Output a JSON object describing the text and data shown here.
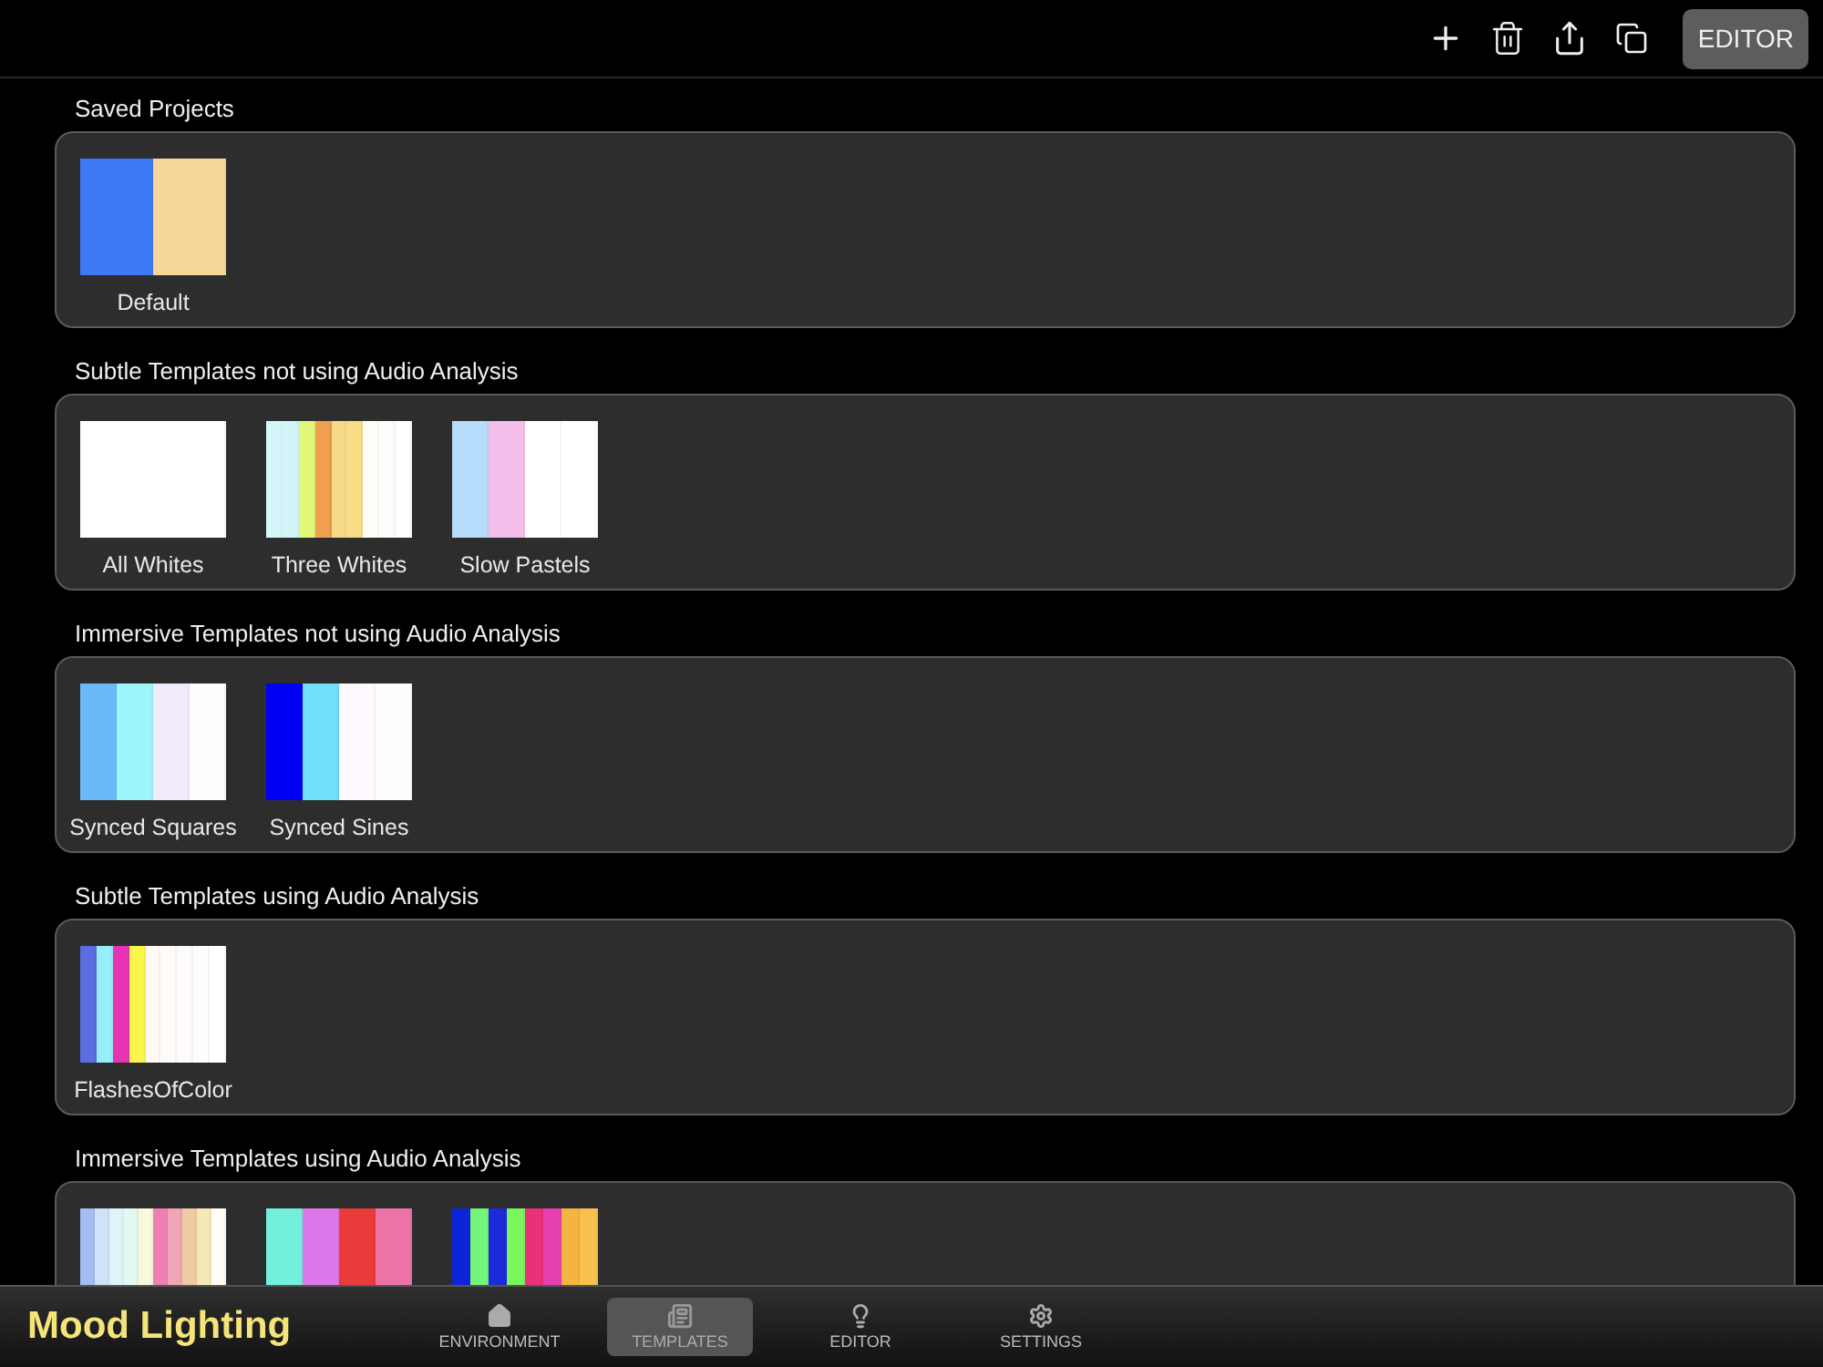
{
  "toolbar": {
    "editor_button": "EDITOR"
  },
  "sections": [
    {
      "title": "Saved Projects",
      "templates": [
        {
          "name": "Default",
          "stripes": [
            {
              "color": "#3d78f5"
            },
            {
              "color": "#f7d79b"
            }
          ]
        }
      ]
    },
    {
      "title": "Subtle Templates not using Audio Analysis",
      "templates": [
        {
          "name": "All Whites",
          "stripes": [
            {
              "color": "#ffffff"
            }
          ]
        },
        {
          "name": "Three Whites",
          "stripes": [
            {
              "color": "#d6f6fb"
            },
            {
              "color": "#d3f5fa"
            },
            {
              "color": "#e1f77a"
            },
            {
              "color": "#ef9f4e"
            },
            {
              "color": "#f7d98a"
            },
            {
              "color": "#f7dd86"
            },
            {
              "color": "#fffdf8"
            },
            {
              "color": "#fdfdfd"
            },
            {
              "color": "#ffffff"
            }
          ]
        },
        {
          "name": "Slow Pastels",
          "stripes": [
            {
              "color": "#b5dcfb"
            },
            {
              "color": "#f3bdec"
            },
            {
              "color": "#ffffff"
            },
            {
              "color": "#ffffff"
            }
          ]
        }
      ]
    },
    {
      "title": "Immersive Templates not using Audio Analysis",
      "templates": [
        {
          "name": "Synced Squares",
          "stripes": [
            {
              "color": "#6bbaf8"
            },
            {
              "color": "#9ef5fa"
            },
            {
              "color": "#f1eafb"
            },
            {
              "color": "#fefcff"
            }
          ]
        },
        {
          "name": "Synced Sines",
          "stripes": [
            {
              "color": "#0000f5"
            },
            {
              "color": "#6fdffa"
            },
            {
              "color": "#fdf9ff"
            },
            {
              "color": "#fffcfd"
            }
          ]
        }
      ]
    },
    {
      "title": "Subtle Templates using Audio Analysis",
      "templates": [
        {
          "name": "FlashesOfColor",
          "stripes": [
            {
              "color": "#5b6ee0"
            },
            {
              "color": "#96eef8"
            },
            {
              "color": "#e733b4"
            },
            {
              "color": "#fbf44b"
            },
            {
              "color": "#fffaf6"
            },
            {
              "color": "#fffbf8"
            },
            {
              "color": "#fefbfe"
            },
            {
              "color": "#fefcfd"
            },
            {
              "color": "#ffffff"
            }
          ]
        }
      ]
    },
    {
      "title": "Immersive Templates using Audio Analysis",
      "templates": [
        {
          "stripes": [
            {
              "color": "#a6bdf1"
            },
            {
              "color": "#cfe2f8"
            },
            {
              "color": "#dff3fb"
            },
            {
              "color": "#e3f8f3"
            },
            {
              "color": "#f7f9dc"
            },
            {
              "color": "#ee7fb5"
            },
            {
              "color": "#f1a5b5"
            },
            {
              "color": "#efcba4"
            },
            {
              "color": "#f6e8b8"
            },
            {
              "color": "#fffdf6"
            }
          ]
        },
        {
          "stripes": [
            {
              "color": "#73f0dc"
            },
            {
              "color": "#dd78ea"
            },
            {
              "color": "#eb3a3a"
            },
            {
              "color": "#ed73a7"
            }
          ]
        },
        {
          "stripes": [
            {
              "color": "#0d24d9"
            },
            {
              "color": "#74f57a"
            },
            {
              "color": "#1c2ad9"
            },
            {
              "color": "#79f560"
            },
            {
              "color": "#e83179"
            },
            {
              "color": "#e63fb0"
            },
            {
              "color": "#f5b43f"
            },
            {
              "color": "#f7c04f"
            }
          ]
        }
      ]
    }
  ],
  "app_title": "Mood Lighting",
  "nav_tabs": [
    {
      "kind": "home",
      "label": "ENVIRONMENT",
      "selected": false
    },
    {
      "kind": "templates",
      "label": "TEMPLATES",
      "selected": true
    },
    {
      "kind": "bulb",
      "label": "EDITOR",
      "selected": false
    },
    {
      "kind": "gear",
      "label": "SETTINGS",
      "selected": false
    }
  ]
}
